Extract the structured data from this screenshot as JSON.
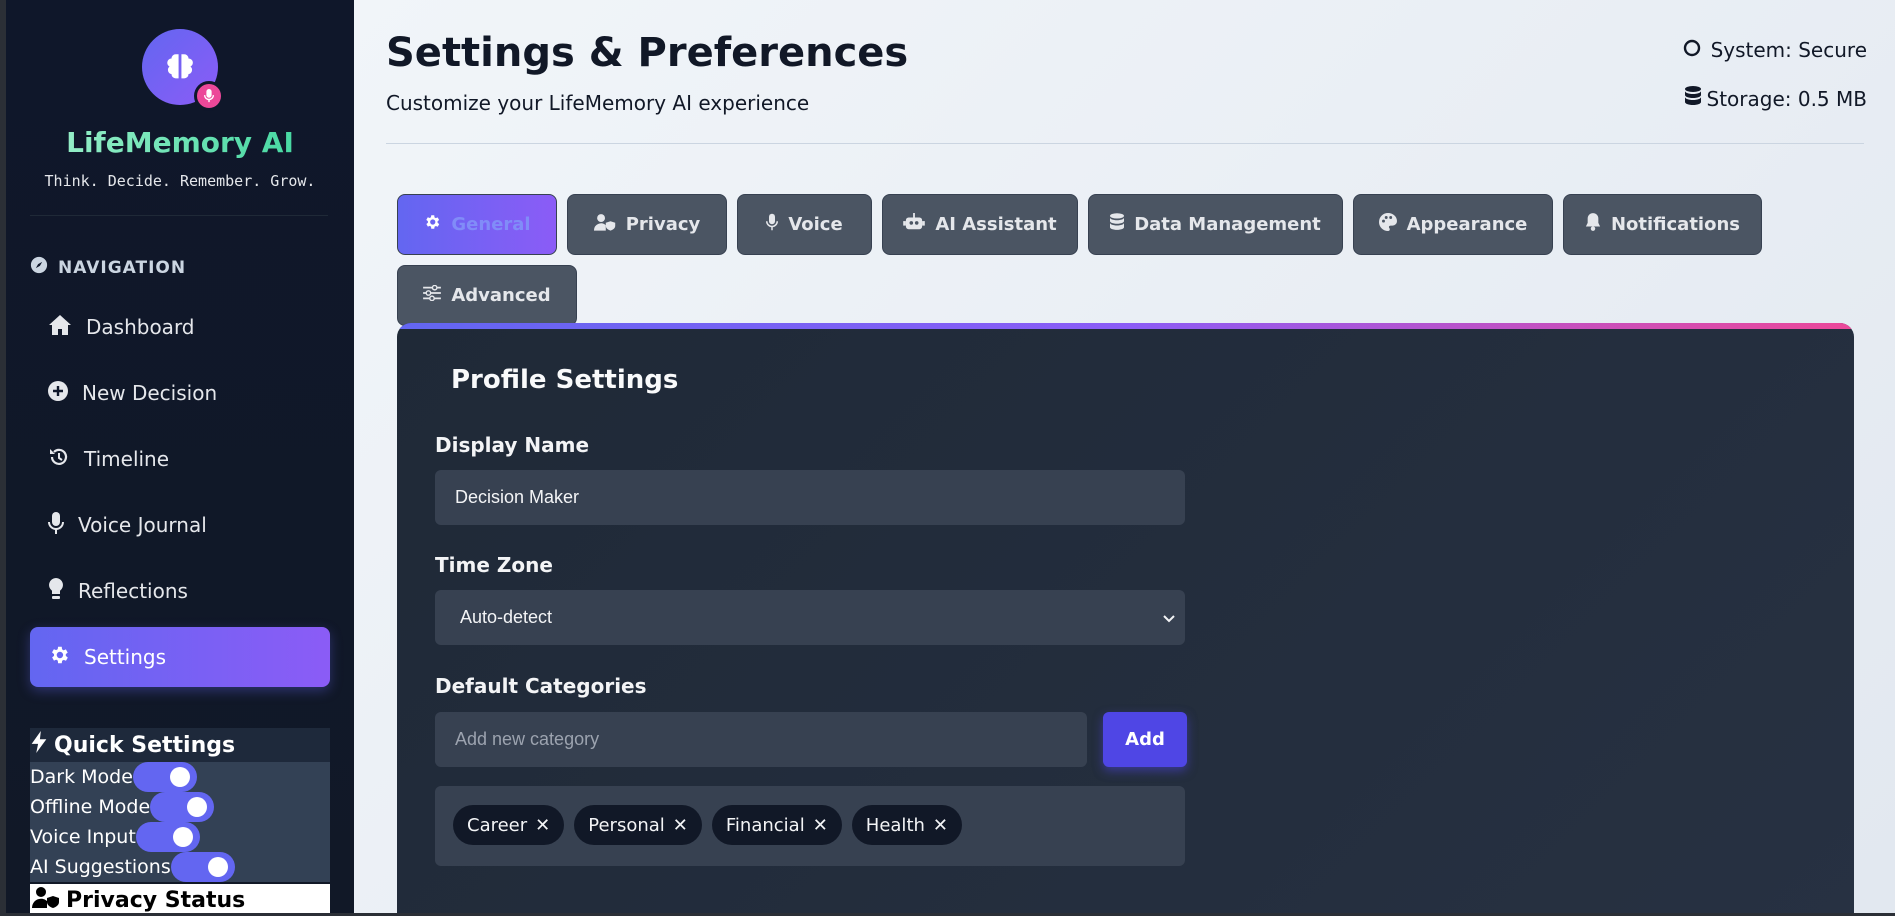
{
  "sidebar": {
    "brand": "LifeMemory AI",
    "tagline": "Think. Decide. Remember. Grow.",
    "nav_heading": "NAVIGATION",
    "items": [
      {
        "label": "Dashboard",
        "icon": "home-icon"
      },
      {
        "label": "New Decision",
        "icon": "plus-circle-icon"
      },
      {
        "label": "Timeline",
        "icon": "history-icon"
      },
      {
        "label": "Voice Journal",
        "icon": "microphone-icon"
      },
      {
        "label": "Reflections",
        "icon": "lightbulb-icon"
      },
      {
        "label": "Settings",
        "icon": "gear-icon",
        "active": true
      }
    ],
    "quick_settings": {
      "title": "Quick Settings",
      "toggles": [
        {
          "label": "Dark Mode",
          "on": true
        },
        {
          "label": "Offline Mode",
          "on": true
        },
        {
          "label": "Voice Input",
          "on": true
        },
        {
          "label": "AI Suggestions",
          "on": true
        }
      ]
    },
    "privacy_status": "Privacy Status"
  },
  "header": {
    "title": "Settings & Preferences",
    "subtitle": "Customize your LifeMemory AI experience",
    "system_status": "System: Secure",
    "storage": "Storage: 0.5 MB"
  },
  "tabs": [
    {
      "label": "General",
      "icon": "gear-icon",
      "active": true
    },
    {
      "label": "Privacy",
      "icon": "user-shield-icon"
    },
    {
      "label": "Voice",
      "icon": "microphone-icon"
    },
    {
      "label": "AI Assistant",
      "icon": "robot-icon"
    },
    {
      "label": "Data Management",
      "icon": "database-icon"
    },
    {
      "label": "Appearance",
      "icon": "palette-icon"
    },
    {
      "label": "Notifications",
      "icon": "bell-icon"
    },
    {
      "label": "Advanced",
      "icon": "sliders-icon"
    }
  ],
  "profile": {
    "title": "Profile Settings",
    "display_name_label": "Display Name",
    "display_name_value": "Decision Maker",
    "timezone_label": "Time Zone",
    "timezone_value": "Auto-detect",
    "categories_label": "Default Categories",
    "category_placeholder": "Add new category",
    "add_label": "Add",
    "categories": [
      "Career",
      "Personal",
      "Financial",
      "Health"
    ]
  },
  "colors": {
    "accent": "#6366f1",
    "accent2": "#8b5cf6",
    "pink": "#ec4899",
    "sidebar_bg": "#0f172a"
  }
}
